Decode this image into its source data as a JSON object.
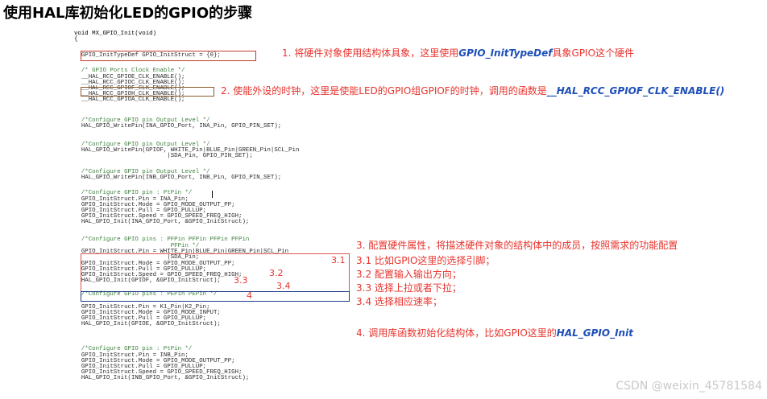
{
  "title": "使用HAL库初始化LED的GPIO的步骤",
  "code_lines": [
    {
      "text": "void MX_GPIO_Init(void)",
      "cls": "kw"
    },
    {
      "text": "{",
      "cls": "kw"
    },
    {
      "text": "  GPIO_InitTypeDef GPIO_InitStruct = {0};",
      "cls": ""
    },
    {
      "text": "",
      "cls": ""
    },
    {
      "text": "  /* GPIO Ports Clock Enable */",
      "cls": "comment"
    },
    {
      "text": "  __HAL_RCC_GPIOE_CLK_ENABLE();",
      "cls": ""
    },
    {
      "text": "  __HAL_RCC_GPIOC_CLK_ENABLE();",
      "cls": ""
    },
    {
      "text": "  __HAL_RCC_GPIOF_CLK_ENABLE();",
      "cls": ""
    },
    {
      "text": "  __HAL_RCC_GPIOH_CLK_ENABLE();",
      "cls": ""
    },
    {
      "text": "  __HAL_RCC_GPIOA_CLK_ENABLE();",
      "cls": ""
    },
    {
      "text": "",
      "cls": ""
    },
    {
      "text": "  /*Configure GPIO pin Output Level */",
      "cls": "comment"
    },
    {
      "text": "  HAL_GPIO_WritePin(INA_GPIO_Port, INA_Pin, GPIO_PIN_SET);",
      "cls": ""
    },
    {
      "text": "",
      "cls": ""
    },
    {
      "text": "  /*Configure GPIO pin Output Level */",
      "cls": "comment"
    },
    {
      "text": "  HAL_GPIO_WritePin(GPIOF, WHITE_Pin|BLUE_Pin|GREEN_Pin|SCL_Pin",
      "cls": ""
    },
    {
      "text": "                          |SDA_Pin, GPIO_PIN_SET);",
      "cls": ""
    },
    {
      "text": "",
      "cls": ""
    },
    {
      "text": "  /*Configure GPIO pin Output Level */",
      "cls": "comment"
    },
    {
      "text": "  HAL_GPIO_WritePin(INB_GPIO_Port, INB_Pin, GPIO_PIN_SET);",
      "cls": ""
    },
    {
      "text": "",
      "cls": ""
    },
    {
      "text": "  /*Configure GPIO pin : PtPin */",
      "cls": "comment"
    },
    {
      "text": "  GPIO_InitStruct.Pin = INA_Pin;",
      "cls": ""
    },
    {
      "text": "  GPIO_InitStruct.Mode = GPIO_MODE_OUTPUT_PP;",
      "cls": ""
    },
    {
      "text": "  GPIO_InitStruct.Pull = GPIO_PULLUP;",
      "cls": ""
    },
    {
      "text": "  GPIO_InitStruct.Speed = GPIO_SPEED_FREQ_HIGH;",
      "cls": ""
    },
    {
      "text": "  HAL_GPIO_Init(INA_GPIO_Port, &GPIO_InitStruct);",
      "cls": ""
    },
    {
      "text": "",
      "cls": ""
    },
    {
      "text": "  /*Configure GPIO pins : PFPin PFPin PFPin PFPin",
      "cls": "comment"
    },
    {
      "text": "                           PFPin */",
      "cls": "comment"
    },
    {
      "text": "  GPIO_InitStruct.Pin = WHITE_Pin|BLUE_Pin|GREEN_Pin|SCL_Pin",
      "cls": ""
    },
    {
      "text": "                          |SDA_Pin;",
      "cls": ""
    },
    {
      "text": "  GPIO_InitStruct.Mode = GPIO_MODE_OUTPUT_PP;",
      "cls": ""
    },
    {
      "text": "  GPIO_InitStruct.Pull = GPIO_PULLUP;",
      "cls": ""
    },
    {
      "text": "  GPIO_InitStruct.Speed = GPIO_SPEED_FREQ_HIGH;",
      "cls": ""
    },
    {
      "text": "  HAL_GPIO_Init(GPIOF, &GPIO_InitStruct);",
      "cls": ""
    },
    {
      "text": "",
      "cls": ""
    },
    {
      "text": "  /*Configure GPIO pins : PEPin PEPin */",
      "cls": "comment"
    },
    {
      "text": "  GPIO_InitStruct.Pin = K1_Pin|K2_Pin;",
      "cls": ""
    },
    {
      "text": "  GPIO_InitStruct.Mode = GPIO_MODE_INPUT;",
      "cls": ""
    },
    {
      "text": "  GPIO_InitStruct.Pull = GPIO_PULLUP;",
      "cls": ""
    },
    {
      "text": "  HAL_GPIO_Init(GPIOE, &GPIO_InitStruct);",
      "cls": ""
    },
    {
      "text": "",
      "cls": ""
    },
    {
      "text": "  /*Configure GPIO pin : PtPin */",
      "cls": "comment"
    },
    {
      "text": "  GPIO_InitStruct.Pin = INB_Pin;",
      "cls": ""
    },
    {
      "text": "  GPIO_InitStruct.Mode = GPIO_MODE_OUTPUT_PP;",
      "cls": ""
    },
    {
      "text": "  GPIO_InitStruct.Pull = GPIO_PULLUP;",
      "cls": ""
    },
    {
      "text": "  GPIO_InitStruct.Speed = GPIO_SPEED_FREQ_HIGH;",
      "cls": ""
    },
    {
      "text": "  HAL_GPIO_Init(INB_GPIO_Port, &GPIO_InitStruct);",
      "cls": ""
    }
  ],
  "annotations": {
    "step1_text": "1. 将硬件对象使用结构体具象，这里使用",
    "step1_em": "GPIO_InitTypeDef",
    "step1_tail": "具象GPIO这个硬件",
    "step2_text": "2. 使能外设的时钟，这里是使能LED的GPIO组GPIOF的时钟，调用的函数是",
    "step2_em": "__HAL_RCC_GPIOF_CLK_ENABLE()",
    "step3": "3. 配置硬件属性，将描述硬件对象的结构体中的成员，按照需求的功能配置",
    "step3_1": "3.1 比如GPIO这里的选择引脚；",
    "step3_2": "3.2 配置输入输出方向；",
    "step3_3": "3.3 选择上拉或者下拉；",
    "step3_4": "3.4 选择相应速率；",
    "step4_text": "4. 调用库函数初始化结构体，比如GPIO这里的",
    "step4_em": "HAL_GPIO_Init"
  },
  "inline_tags": {
    "t31": "3.1",
    "t32": "3.2",
    "t33": "3.3",
    "t34": "3.4",
    "t4": "4"
  },
  "watermark": "CSDN @weixin_45781584"
}
